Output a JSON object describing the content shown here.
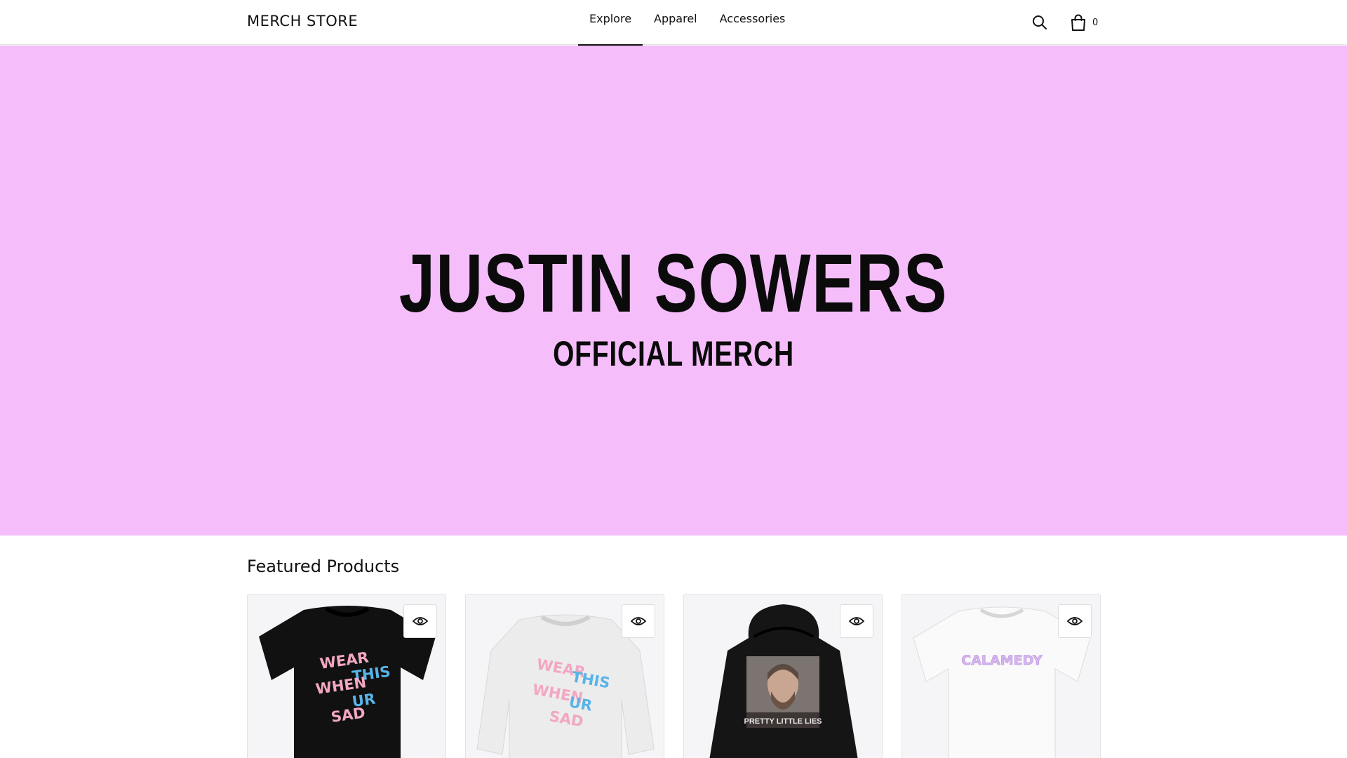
{
  "header": {
    "brand": "MERCH STORE",
    "nav": [
      {
        "label": "Explore",
        "active": true
      },
      {
        "label": "Apparel",
        "active": false
      },
      {
        "label": "Accessories",
        "active": false
      }
    ],
    "search_icon": "search-icon",
    "cart_icon": "shopping-bag-icon",
    "cart_count": "0"
  },
  "hero": {
    "background": "#f5befb",
    "title": "JUSTIN SOWERS",
    "subtitle": "OFFICIAL MERCH"
  },
  "featured": {
    "heading": "Featured Products",
    "products": [
      {
        "garment": "t-shirt",
        "color": "#111111",
        "print": [
          "WEAR",
          "THIS",
          "WHEN",
          "UR",
          "SAD"
        ]
      },
      {
        "garment": "sweatshirt",
        "color": "#eeeeee",
        "print": [
          "WEAR",
          "THIS",
          "WHEN",
          "UR",
          "SAD"
        ]
      },
      {
        "garment": "hoodie",
        "color": "#151515",
        "print": [
          "PRETTY LITTLE LIES"
        ]
      },
      {
        "garment": "t-shirt",
        "color": "#fafafa",
        "print": [
          "CALAMEDY"
        ]
      }
    ],
    "quick_view_icon": "eye-icon"
  }
}
